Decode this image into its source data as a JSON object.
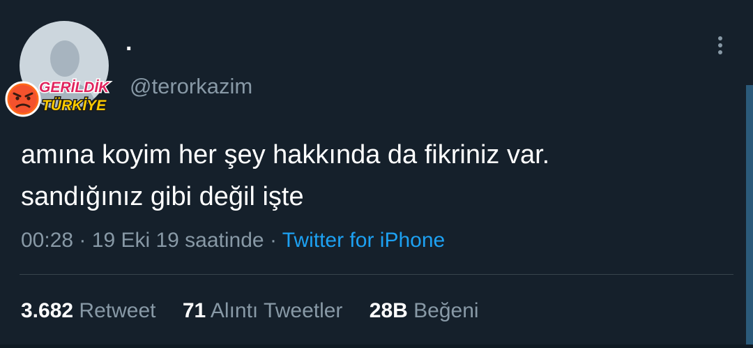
{
  "tweet": {
    "display_name": "·",
    "handle": "@terorkazim",
    "text_lines": [
      "amına koyim her şey hakkında da fikriniz var.",
      "sandığınız gibi değil işte"
    ],
    "time": "00:28",
    "separator": "·",
    "date": "19 Eki 19 saatinde",
    "source": "Twitter for iPhone"
  },
  "stats": {
    "retweets_count": "3.682",
    "retweets_label": "Retweet",
    "quotes_count": "71",
    "quotes_label": "Alıntı Tweetler",
    "likes_count": "28B",
    "likes_label": "Beğeni"
  },
  "watermark": {
    "line1": "GERİLDİK",
    "line2": "TÜRKİYE"
  },
  "colors": {
    "background": "#15202b",
    "text": "#ffffff",
    "secondary": "#8899a6",
    "link": "#1da1f2",
    "divider": "#38444d",
    "watermark_red": "#e0245e",
    "watermark_yellow": "#ffcc00"
  },
  "icons": [
    "more-vertical-icon",
    "angry-face-icon"
  ]
}
